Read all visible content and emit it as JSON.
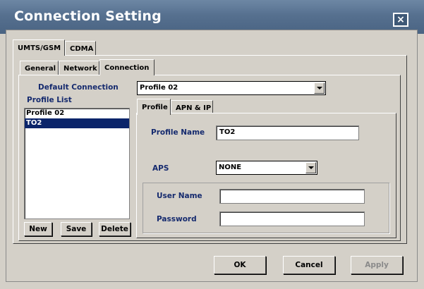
{
  "window": {
    "title": "Connection Setting",
    "close_label": "×"
  },
  "top_tabs": [
    {
      "label": "UMTS/GSM"
    },
    {
      "label": "CDMA"
    }
  ],
  "sub_tabs": [
    {
      "label": "General"
    },
    {
      "label": "Network"
    },
    {
      "label": "Connection"
    }
  ],
  "connection": {
    "default_connection_label": "Default Connection",
    "default_connection_value": "Profile 02",
    "profile_list_label": "Profile List",
    "profiles": [
      "Profile 02",
      "TO2"
    ],
    "selected_profile": "TO2",
    "new_label": "New",
    "save_label": "Save",
    "delete_label": "Delete"
  },
  "profile_tabs": [
    {
      "label": "Profile"
    },
    {
      "label": "APN & IP"
    }
  ],
  "profile": {
    "name_label": "Profile Name",
    "name_value": "TO2",
    "aps_label": "APS",
    "aps_value": "NONE",
    "username_label": "User Name",
    "username_value": "",
    "password_label": "Password",
    "password_value": ""
  },
  "footer": {
    "ok_label": "OK",
    "cancel_label": "Cancel",
    "apply_label": "Apply"
  },
  "colors": {
    "title_bar": "#56708f",
    "label_text": "#152a6e",
    "selection": "#0a246a"
  }
}
